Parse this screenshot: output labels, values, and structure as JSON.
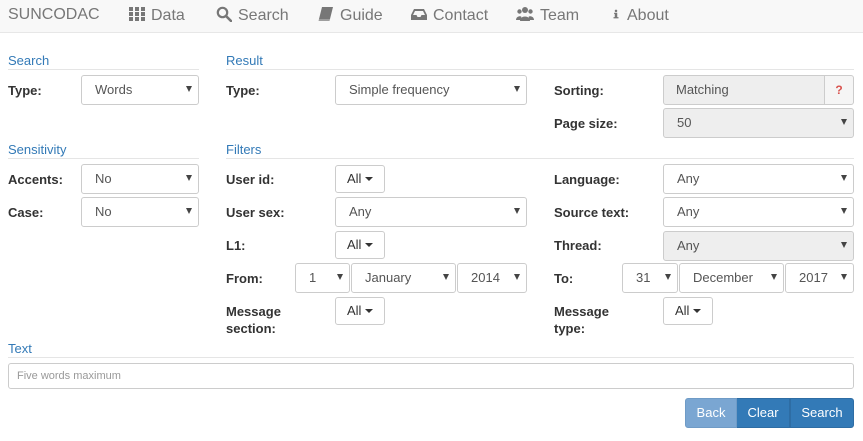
{
  "nav": {
    "brand": "SUNCODAC",
    "items": [
      {
        "label": "Data",
        "icon": "grid-icon"
      },
      {
        "label": "Search",
        "icon": "search-icon"
      },
      {
        "label": "Guide",
        "icon": "book-icon"
      },
      {
        "label": "Contact",
        "icon": "inbox-icon"
      },
      {
        "label": "Team",
        "icon": "users-icon"
      },
      {
        "label": "About",
        "icon": "info-icon"
      }
    ]
  },
  "search": {
    "title": "Search",
    "type_label": "Type:",
    "type_value": "Words"
  },
  "sensitivity": {
    "title": "Sensitivity",
    "accents_label": "Accents:",
    "accents_value": "No",
    "case_label": "Case:",
    "case_value": "No"
  },
  "result": {
    "title": "Result",
    "type_label": "Type:",
    "type_value": "Simple frequency",
    "sorting_label": "Sorting:",
    "sorting_value": "Matching",
    "sorting_help": "?",
    "page_size_label": "Page size:",
    "page_size_value": "50"
  },
  "filters": {
    "title": "Filters",
    "user_id_label": "User id:",
    "user_id_value": "All",
    "user_sex_label": "User sex:",
    "user_sex_value": "Any",
    "l1_label": "L1:",
    "l1_value": "All",
    "from_label": "From:",
    "from_day": "1",
    "from_month": "January",
    "from_year": "2014",
    "message_section_label_1": "Message",
    "message_section_label_2": "section:",
    "message_section_value": "All",
    "language_label": "Language:",
    "language_value": "Any",
    "source_text_label": "Source text:",
    "source_text_value": "Any",
    "thread_label": "Thread:",
    "thread_value": "Any",
    "to_label": "To:",
    "to_day": "31",
    "to_month": "December",
    "to_year": "2017",
    "message_type_label_1": "Message",
    "message_type_label_2": "type:",
    "message_type_value": "All"
  },
  "text": {
    "title": "Text",
    "placeholder": "Five words maximum"
  },
  "buttons": {
    "back": "Back",
    "clear": "Clear",
    "search": "Search"
  }
}
